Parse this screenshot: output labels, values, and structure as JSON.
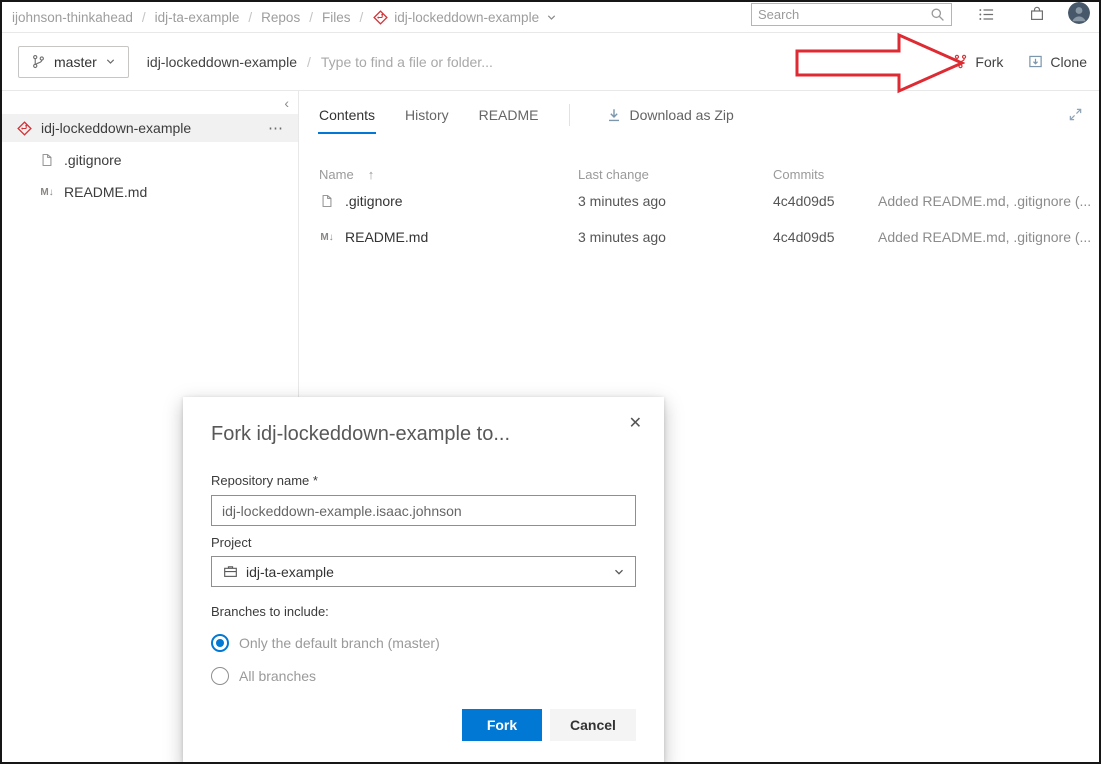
{
  "colors": {
    "primary": "#0078d4",
    "repo_icon_red": "#d13438",
    "annotation_arrow_red": "#de2a32"
  },
  "topbar": {
    "breadcrumbs": [
      "ijohnson-thinkahead",
      "idj-ta-example",
      "Repos",
      "Files"
    ],
    "repo_crumb": "idj-lockeddown-example",
    "search_placeholder": "Search"
  },
  "toolbar": {
    "branch": "master",
    "repo_name": "idj-lockeddown-example",
    "finder_placeholder": "Type to find a file or folder...",
    "fork": "Fork",
    "clone": "Clone"
  },
  "sidebar": {
    "repo": "idj-lockeddown-example",
    "files": [
      {
        "name": ".gitignore",
        "type": "file"
      },
      {
        "name": "README.md",
        "type": "markdown"
      }
    ]
  },
  "main": {
    "tabs": [
      {
        "label": "Contents",
        "active": true
      },
      {
        "label": "History",
        "active": false
      },
      {
        "label": "README",
        "active": false
      }
    ],
    "download_zip": "Download as Zip",
    "table": {
      "headers": {
        "name": "Name",
        "last_change": "Last change",
        "commits": "Commits"
      },
      "rows": [
        {
          "name": ".gitignore",
          "icon": "file",
          "last_change": "3 minutes ago",
          "commit": "4c4d09d5",
          "message": "Added README.md, .gitignore (..."
        },
        {
          "name": "README.md",
          "icon": "markdown",
          "last_change": "3 minutes ago",
          "commit": "4c4d09d5",
          "message": "Added README.md, .gitignore (..."
        }
      ]
    }
  },
  "dialog": {
    "title": "Fork idj-lockeddown-example to...",
    "repository_name_label": "Repository name *",
    "repository_name_value": "idj-lockeddown-example.isaac.johnson",
    "project_label": "Project",
    "project_value": "idj-ta-example",
    "branches_label": "Branches to include:",
    "options": [
      {
        "label": "Only the default branch (master)",
        "selected": true
      },
      {
        "label": "All branches",
        "selected": false
      }
    ],
    "fork_button": "Fork",
    "cancel_button": "Cancel"
  },
  "icons": {
    "more": "⋯",
    "close": "✕",
    "sort_asc": "↑",
    "markdown": "M↓",
    "collapse": "‹"
  }
}
